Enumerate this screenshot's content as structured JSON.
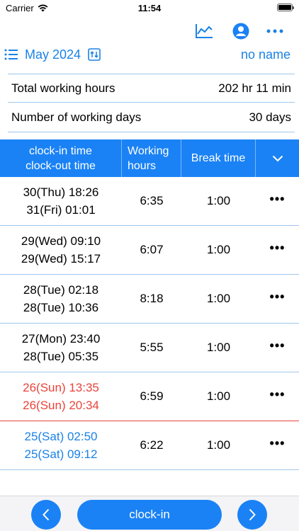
{
  "status_bar": {
    "carrier": "Carrier",
    "time": "11:54"
  },
  "nav": {
    "icons": [
      "chart-icon",
      "profile-icon",
      "more-icon"
    ]
  },
  "subheader": {
    "month": "May 2024",
    "name": "no name"
  },
  "summary": {
    "total_label": "Total working hours",
    "total_value": "202 hr 11 min",
    "days_label": "Number of working days",
    "days_value": "30 days"
  },
  "table": {
    "headers": {
      "times_line1": "clock-in time",
      "times_line2": "clock-out time",
      "hours_line1": "Working",
      "hours_line2": "hours",
      "break": "Break time"
    },
    "rows": [
      {
        "in": "30(Thu) 18:26",
        "out": "31(Fri) 01:01",
        "hours": "6:35",
        "break": "1:00",
        "day_type": "weekday"
      },
      {
        "in": "29(Wed) 09:10",
        "out": "29(Wed) 15:17",
        "hours": "6:07",
        "break": "1:00",
        "day_type": "weekday"
      },
      {
        "in": "28(Tue) 02:18",
        "out": "28(Tue) 10:36",
        "hours": "8:18",
        "break": "1:00",
        "day_type": "weekday"
      },
      {
        "in": "27(Mon) 23:40",
        "out": "28(Tue) 05:35",
        "hours": "5:55",
        "break": "1:00",
        "day_type": "weekday"
      },
      {
        "in": "26(Sun) 13:35",
        "out": "26(Sun) 20:34",
        "hours": "6:59",
        "break": "1:00",
        "day_type": "sunday"
      },
      {
        "in": "25(Sat) 02:50",
        "out": "25(Sat) 09:12",
        "hours": "6:22",
        "break": "1:00",
        "day_type": "saturday"
      }
    ],
    "more_label": "•••"
  },
  "toolbar": {
    "clockin_label": "clock-in"
  },
  "colors": {
    "accent": "#1a82f5",
    "sunday": "#e8443a",
    "saturday": "#1a82e6",
    "divider": "#9fc7ee"
  }
}
